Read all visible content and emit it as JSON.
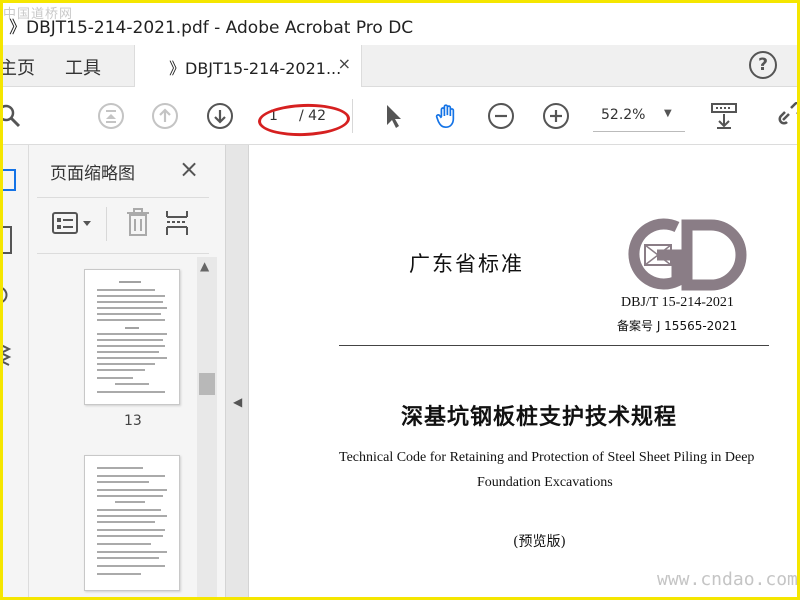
{
  "window": {
    "title": "》DBJT15-214-2021.pdf - Adobe Acrobat Pro DC"
  },
  "watermarks": {
    "top_left": "中国道桥网",
    "bottom_right": "www.cndao.com"
  },
  "tabs": {
    "home": "主页",
    "tools": "工具",
    "document": "》DBJT15-214-2021...",
    "close": "×",
    "help": "?"
  },
  "toolbar": {
    "page_current": "1",
    "page_total": "/ 42",
    "zoom": "52.2%",
    "icons": [
      "search-icon",
      "first-page-icon",
      "prev-page-icon",
      "next-page-icon",
      "select-arrow-icon",
      "hand-icon",
      "zoom-out-icon",
      "zoom-in-icon",
      "zoom-dropdown-icon",
      "scroll-mode-icon",
      "link-icon"
    ]
  },
  "thumbnails": {
    "title": "页面缩略图",
    "close": "×",
    "pages": [
      {
        "label": "13"
      }
    ]
  },
  "document": {
    "header": "广东省标准",
    "logo": "GD",
    "code": "DBJ/T 15-214-2021",
    "record": "备案号  J  15565-2021",
    "title": "深基坑钢板桩支护技术规程",
    "english_line1": "Technical Code for Retaining and Protection of Steel Sheet Piling in Deep",
    "english_line2": "Foundation Excavations",
    "edition": "(预览版)"
  },
  "colors": {
    "highlight_oval": "#d62020",
    "hand_tool_active": "#1473e6",
    "border": "#f5e600"
  }
}
